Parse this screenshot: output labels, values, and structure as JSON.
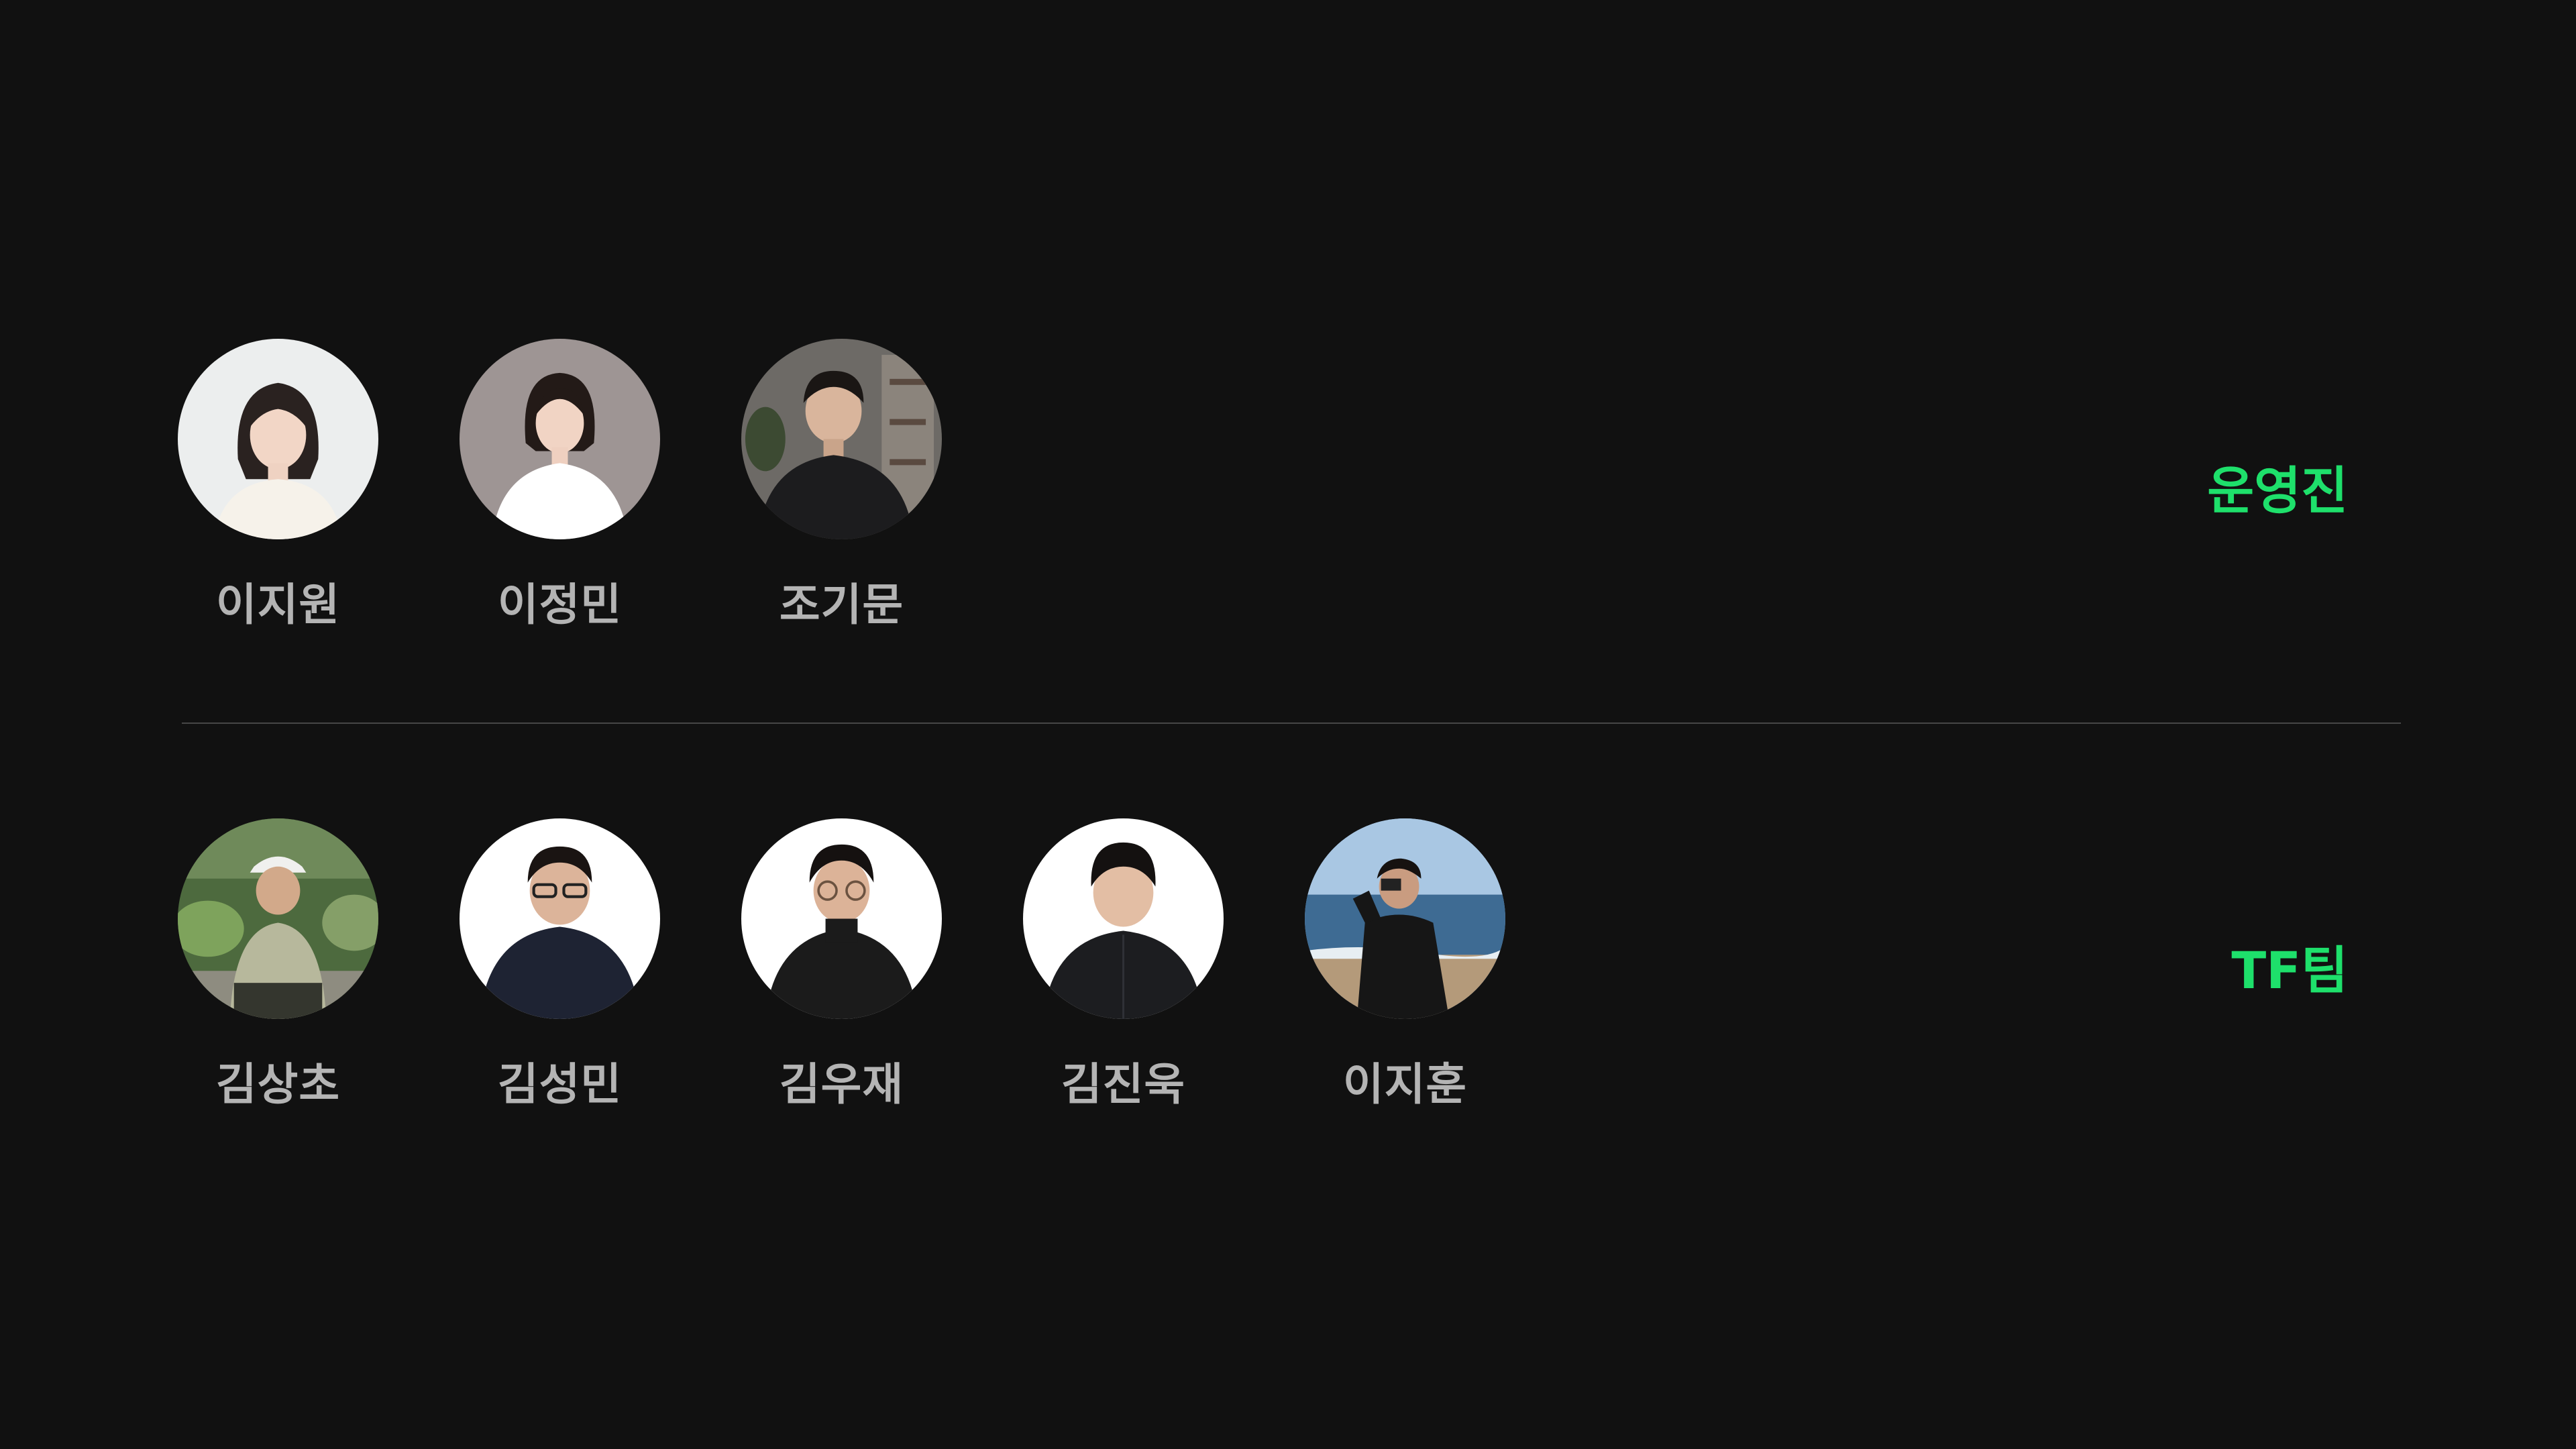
{
  "groups": [
    {
      "label": "운영진",
      "members": [
        {
          "name": "이지원"
        },
        {
          "name": "이정민"
        },
        {
          "name": "조기문"
        }
      ]
    },
    {
      "label": "TF팀",
      "members": [
        {
          "name": "김상초"
        },
        {
          "name": "김성민"
        },
        {
          "name": "김우재"
        },
        {
          "name": "김진욱"
        },
        {
          "name": "이지훈"
        }
      ]
    }
  ],
  "colors": {
    "background": "#111111",
    "accent": "#1ee06b",
    "name_text": "#b4b4b4",
    "divider": "#474747"
  }
}
